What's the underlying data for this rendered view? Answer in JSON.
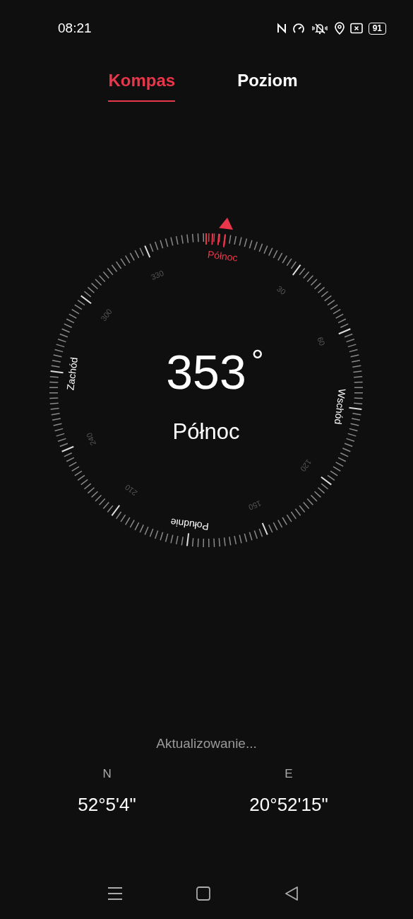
{
  "status_bar": {
    "time": "08:21",
    "battery": "91"
  },
  "tabs": [
    {
      "label": "Kompas",
      "selected": true
    },
    {
      "label": "Poziom",
      "selected": false
    }
  ],
  "compass": {
    "heading": "353",
    "unit": "°",
    "direction": "Północ",
    "dial_labels": [
      {
        "text": "Północ",
        "kind": "cardinal",
        "highlighted": true
      },
      {
        "text": "30",
        "kind": "degree",
        "highlighted": false
      },
      {
        "text": "60",
        "kind": "degree",
        "highlighted": false
      },
      {
        "text": "Wschód",
        "kind": "cardinal",
        "highlighted": false
      },
      {
        "text": "120",
        "kind": "degree",
        "highlighted": false
      },
      {
        "text": "150",
        "kind": "degree",
        "highlighted": false
      },
      {
        "text": "Południe",
        "kind": "cardinal",
        "highlighted": false
      },
      {
        "text": "210",
        "kind": "degree",
        "highlighted": false
      },
      {
        "text": "240",
        "kind": "degree",
        "highlighted": false
      },
      {
        "text": "Zachód",
        "kind": "cardinal",
        "highlighted": false
      },
      {
        "text": "300",
        "kind": "degree",
        "highlighted": false
      },
      {
        "text": "330",
        "kind": "degree",
        "highlighted": false
      }
    ]
  },
  "status": "Aktualizowanie...",
  "coordinates": [
    {
      "label": "N",
      "value": "52°5'4\""
    },
    {
      "label": "E",
      "value": "20°52'15\""
    }
  ]
}
